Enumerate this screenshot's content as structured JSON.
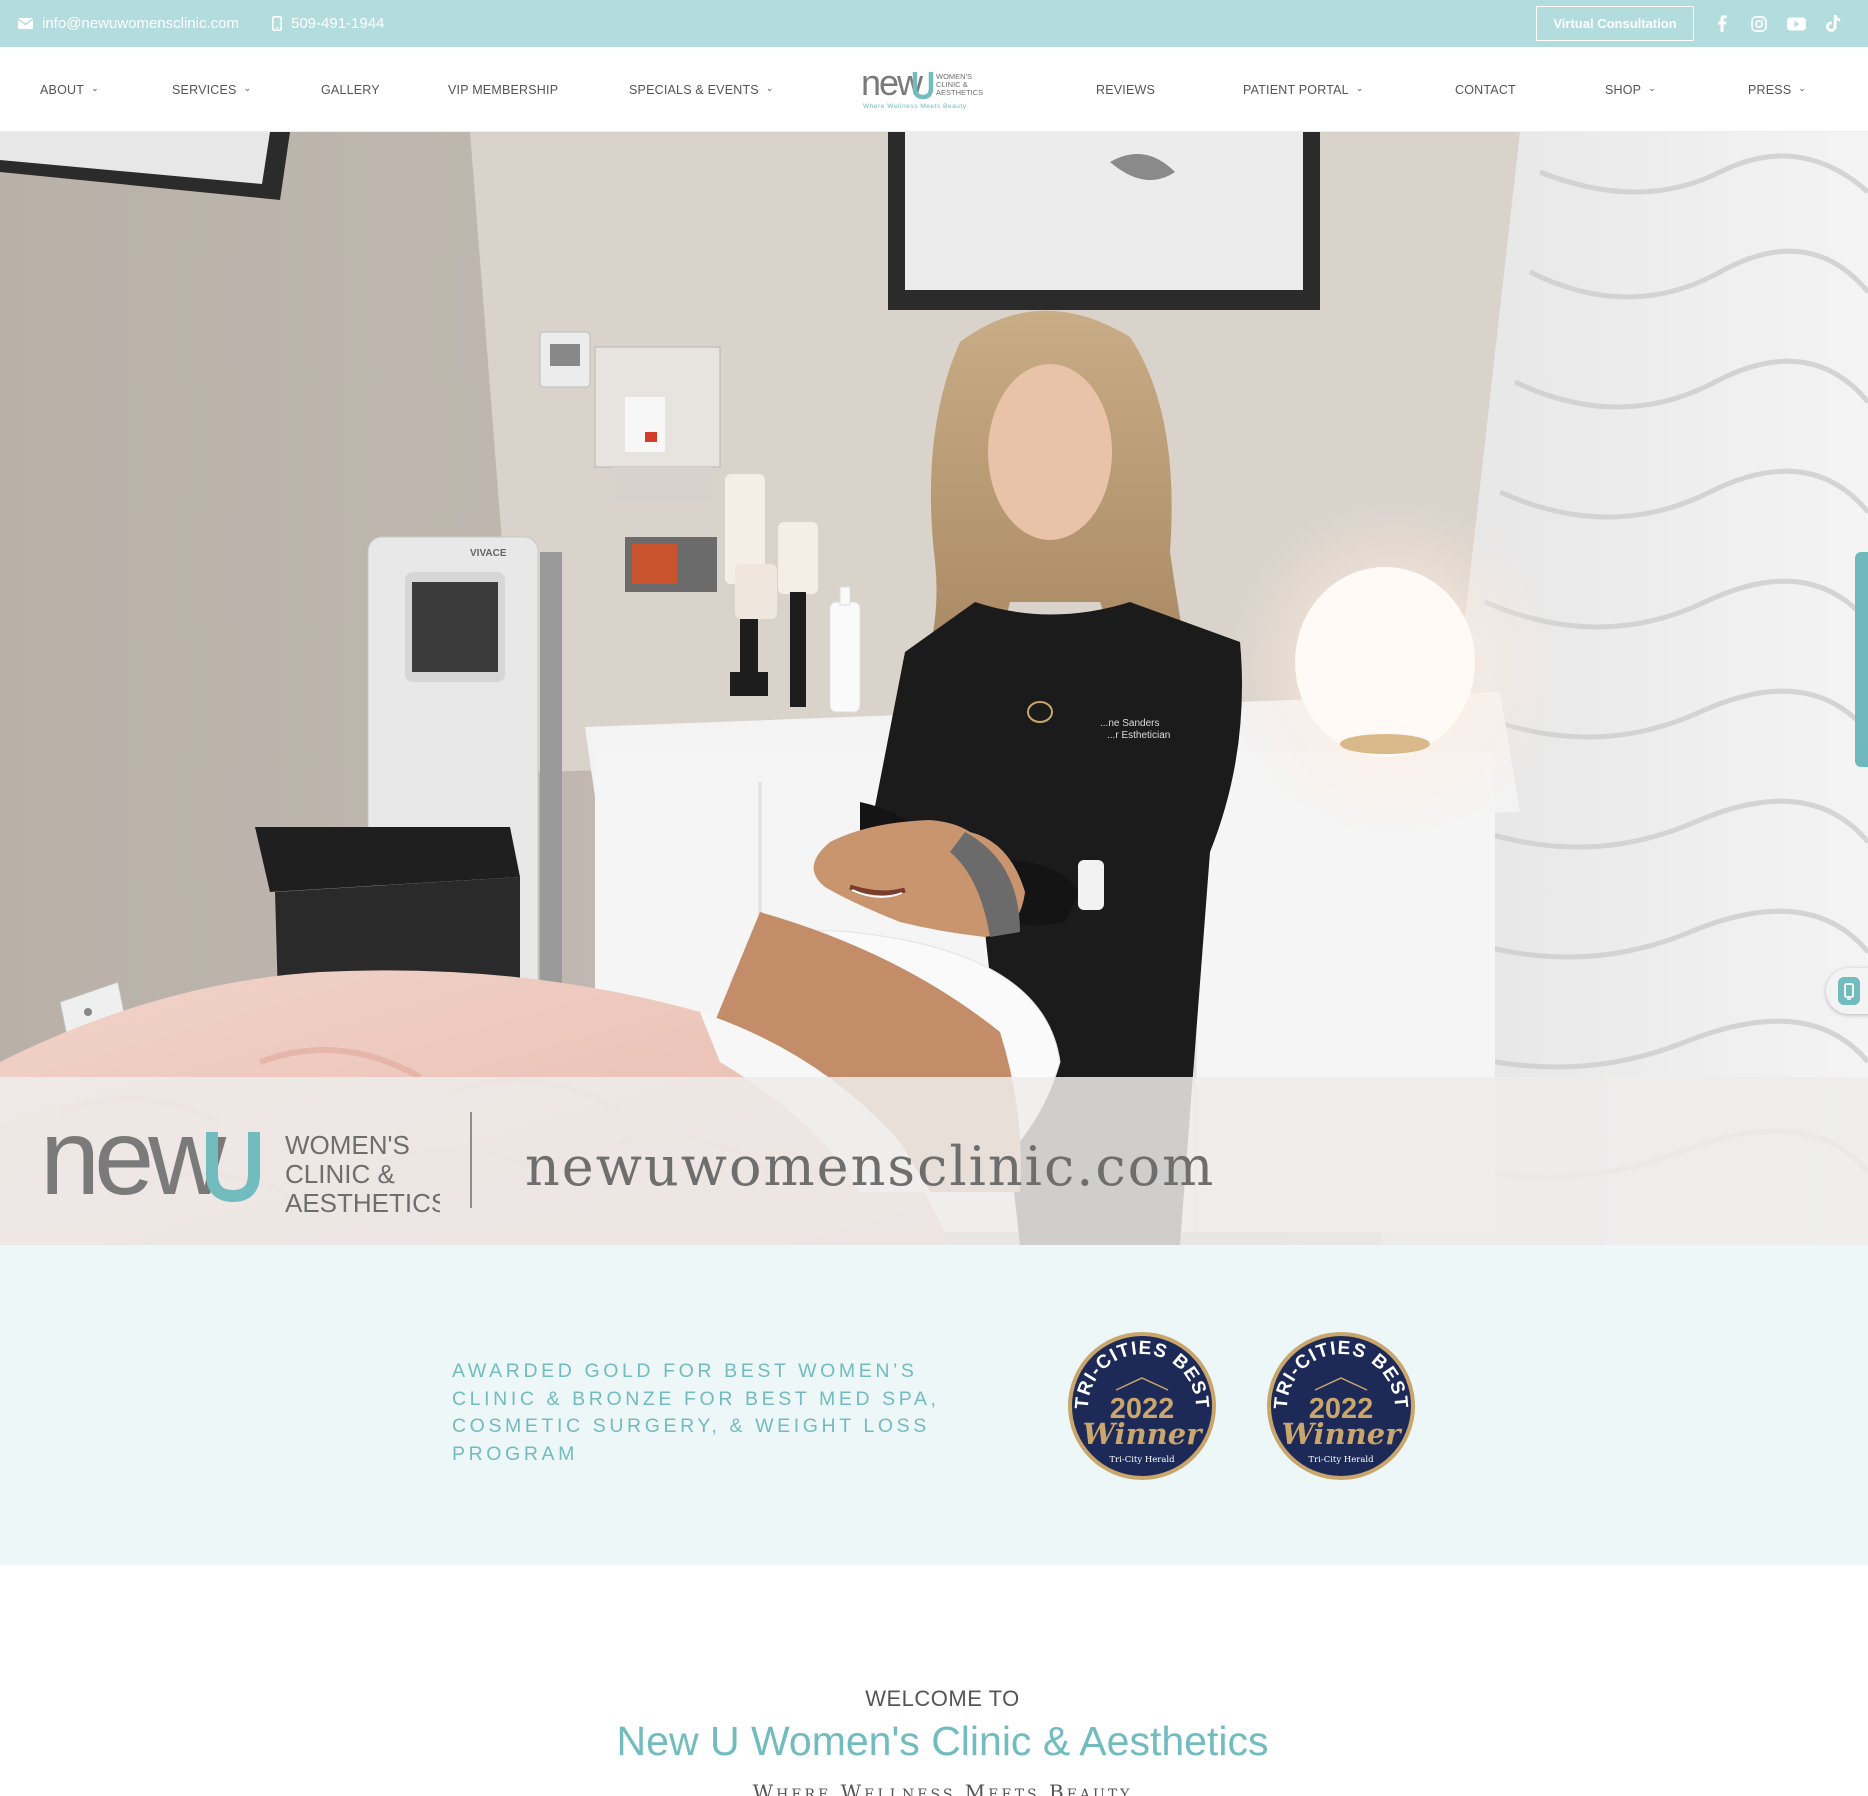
{
  "topbar": {
    "email": "info@newuwomensclinic.com",
    "phone": "509-491-1944",
    "cta_label": "Virtual Consultation",
    "social": [
      "facebook-icon",
      "instagram-icon",
      "youtube-icon",
      "tiktok-icon"
    ]
  },
  "nav": {
    "items": [
      {
        "label": "ABOUT",
        "has_dropdown": true
      },
      {
        "label": "SERVICES",
        "has_dropdown": true
      },
      {
        "label": "GALLERY",
        "has_dropdown": false
      },
      {
        "label": "VIP MEMBERSHIP",
        "has_dropdown": false
      },
      {
        "label": "SPECIALS & EVENTS",
        "has_dropdown": true
      },
      {
        "label": "REVIEWS",
        "has_dropdown": false
      },
      {
        "label": "PATIENT PORTAL",
        "has_dropdown": true
      },
      {
        "label": "CONTACT",
        "has_dropdown": false
      },
      {
        "label": "SHOP",
        "has_dropdown": true
      },
      {
        "label": "PRESS",
        "has_dropdown": true
      }
    ],
    "logo": {
      "wordmark": "new",
      "line1": "WOMEN'S",
      "line2": "CLINIC &",
      "line3": "AESTHETICS",
      "tagline": "Where Wellness Meets Beauty"
    }
  },
  "hero": {
    "band_logo": {
      "wordmark": "new",
      "line1": "WOMEN'S",
      "line2": "CLINIC &",
      "line3": "AESTHETICS"
    },
    "band_url": "newuwomensclinic.com",
    "scrub_name": "...ne Sanders",
    "scrub_title": "...r Esthetician",
    "device_label": "VIVACE"
  },
  "awards": {
    "text": "Awarded Gold for Best Women’s Clinic & Bronze for Best Med Spa, Cosmetic Surgery, & Weight Loss Program",
    "badges": [
      {
        "arc": "TRI-CITIES BEST",
        "year": "2022",
        "label": "Winner",
        "source": "Tri-City Herald"
      },
      {
        "arc": "TRI-CITIES BEST",
        "year": "2022",
        "label": "Winner",
        "source": "Tri-City Herald"
      }
    ]
  },
  "welcome": {
    "kicker": "WELCOME TO",
    "title": "New U Women's Clinic & Aesthetics",
    "subtitle": "Where Wellness Meets Beauty"
  },
  "colors": {
    "accent": "#72bbbf",
    "topbar": "#b3dcdf",
    "awards_bg": "#eef7f7",
    "badge_navy": "#1d2956",
    "badge_gold": "#c9a66b"
  }
}
